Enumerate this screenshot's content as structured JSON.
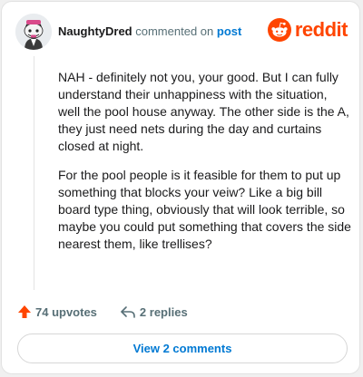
{
  "header": {
    "username": "NaughtyDred",
    "action_text": "commented on",
    "target_text": "post"
  },
  "brand": {
    "name": "reddit",
    "color": "#ff4500",
    "icon": "reddit-alien-icon"
  },
  "comment": {
    "paragraphs": [
      "NAH - definitely not you, your good. But I can fully understand their unhappiness with the situation, well the pool house anyway. The other side is the A, they just need nets during the day and curtains closed at night.",
      "For the pool people is it feasible for them to put up something that blocks your veiw? Like a big bill board type thing, obviously that will look terrible, so maybe you could put something that covers the side nearest them, like trellises?"
    ]
  },
  "actions": {
    "upvotes_label": "74 upvotes",
    "upvote_icon": "upvote-arrow-icon",
    "replies_label": "2 replies",
    "reply_icon": "reply-arrow-icon"
  },
  "footer": {
    "view_comments_label": "View 2 comments"
  },
  "colors": {
    "link": "#0079d3",
    "text": "#1a1a1b",
    "muted": "#576f76",
    "upvote": "#ff4500"
  }
}
